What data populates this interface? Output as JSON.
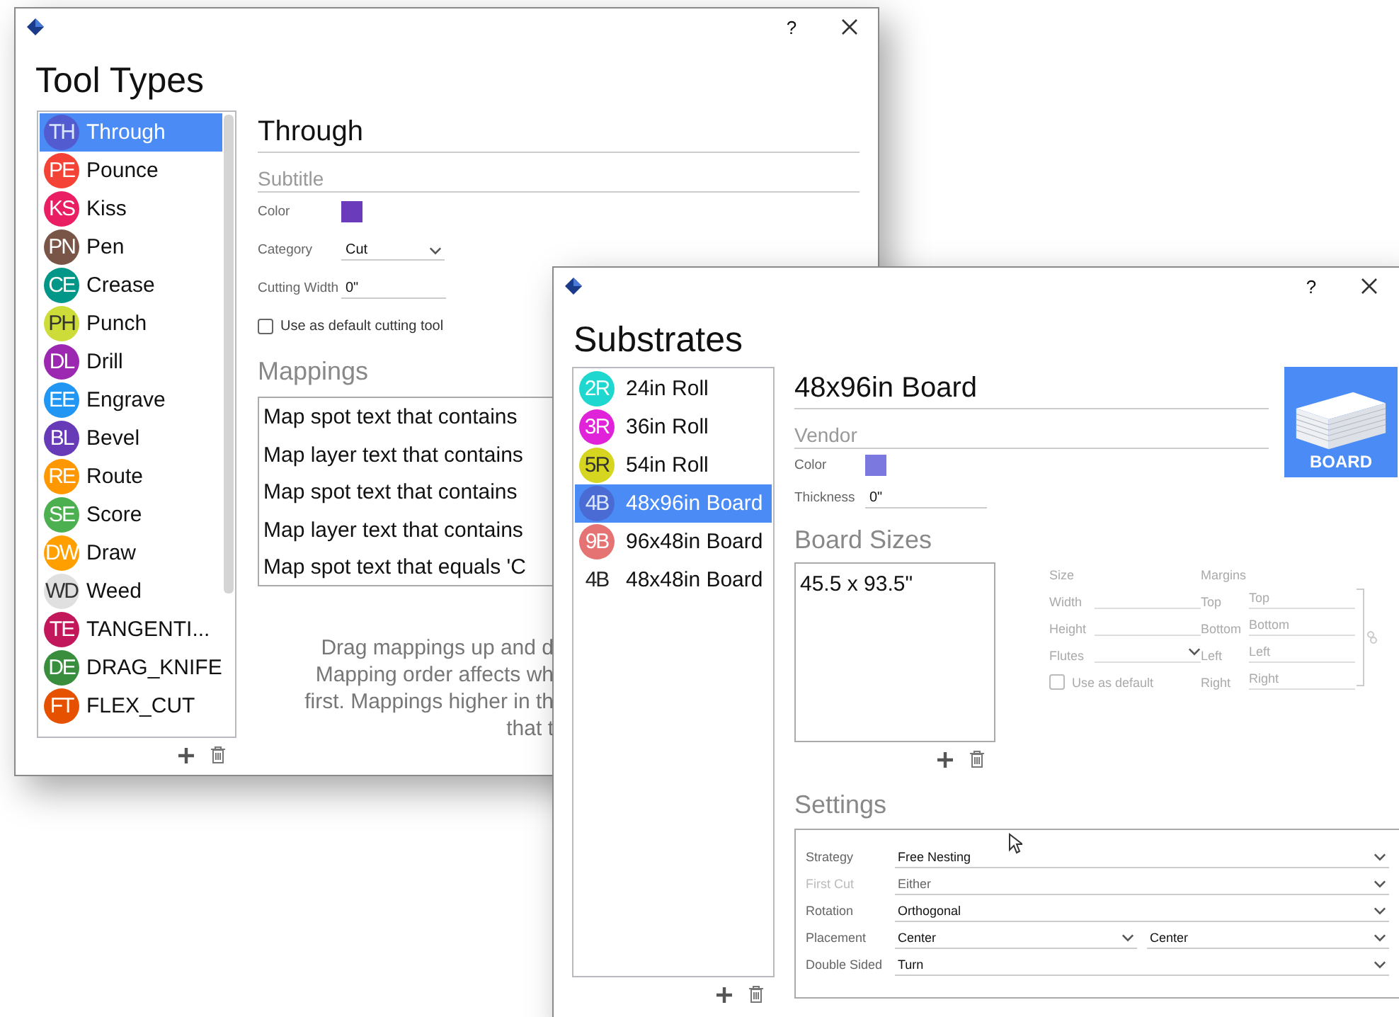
{
  "tool_types_window": {
    "help_button": "?",
    "title": "Tool Types",
    "tools": [
      {
        "initials": "TH",
        "label": "Through",
        "color": "#5450c8",
        "selected": true
      },
      {
        "initials": "PE",
        "label": "Pounce",
        "color": "#f44336",
        "selected": false
      },
      {
        "initials": "KS",
        "label": "Kiss",
        "color": "#e91e63",
        "selected": false
      },
      {
        "initials": "PN",
        "label": "Pen",
        "color": "#795548",
        "selected": false
      },
      {
        "initials": "CE",
        "label": "Crease",
        "color": "#009688",
        "selected": false
      },
      {
        "initials": "PH",
        "label": "Punch",
        "color": "#cddc39",
        "selected": false
      },
      {
        "initials": "DL",
        "label": "Drill",
        "color": "#9c27b0",
        "selected": false
      },
      {
        "initials": "EE",
        "label": "Engrave",
        "color": "#2196f3",
        "selected": false
      },
      {
        "initials": "BL",
        "label": "Bevel",
        "color": "#673ab7",
        "selected": false
      },
      {
        "initials": "RE",
        "label": "Route",
        "color": "#ff9800",
        "selected": false
      },
      {
        "initials": "SE",
        "label": "Score",
        "color": "#4caf50",
        "selected": false
      },
      {
        "initials": "DW",
        "label": "Draw",
        "color": "#ffa000",
        "selected": false
      },
      {
        "initials": "WD",
        "label": "Weed",
        "color": "#e0e0e0",
        "selected": false
      },
      {
        "initials": "TE",
        "label": "TANGENTI...",
        "color": "#c2185b",
        "selected": false
      },
      {
        "initials": "DE",
        "label": "DRAG_KNIFE",
        "color": "#388e3c",
        "selected": false
      },
      {
        "initials": "FT",
        "label": "FLEX_CUT",
        "color": "#e65100",
        "selected": false
      }
    ],
    "name": "Through",
    "subtitle_placeholder": "Subtitle",
    "color_label": "Color",
    "color": "#6a3cbc",
    "category_label": "Category",
    "category": "Cut",
    "cutting_width_label": "Cutting Width",
    "cutting_width": "0\"",
    "default_checkbox": {
      "label": "Use as default cutting tool",
      "checked": false
    },
    "mappings_heading": "Mappings",
    "mappings": [
      "Map spot text that contains",
      "Map layer text that contains",
      "Map spot text that contains",
      "Map layer text that contains",
      "Map spot text that equals 'C"
    ],
    "help_lines": [
      "Drag mappings up and d",
      "Mapping order affects wh",
      "first. Mappings higher in th",
      "that t"
    ]
  },
  "substrates_window": {
    "help_button": "?",
    "title": "Substrates",
    "substrates": [
      {
        "initials": "2R",
        "label": "24in Roll",
        "color": "#1ed8d0",
        "selected": false
      },
      {
        "initials": "3R",
        "label": "36in Roll",
        "color": "#e022d8",
        "selected": false
      },
      {
        "initials": "5R",
        "label": "54in Roll",
        "color": "#d6d620",
        "selected": false
      },
      {
        "initials": "4B",
        "label": "48x96in Board",
        "color": "#4a64cc",
        "selected": true
      },
      {
        "initials": "9B",
        "label": "96x48in Board",
        "color": "#e57373",
        "selected": false
      },
      {
        "initials": "4B",
        "label": "48x48in Board",
        "selected": false
      }
    ],
    "name": "48x96in Board",
    "vendor_placeholder": "Vendor",
    "color_label": "Color",
    "color": "#7b78e0",
    "thickness_label": "Thickness",
    "thickness": "0\"",
    "image_label": "BOARD",
    "board_sizes_heading": "Board Sizes",
    "board_sizes": [
      "45.5 x 93.5\""
    ],
    "size_heading": "Size",
    "width_label": "Width",
    "height_label": "Height",
    "flutes_label": "Flutes",
    "size_default_checkbox": {
      "label": "Use as default",
      "checked": false
    },
    "margins_heading": "Margins",
    "margins": [
      {
        "label": "Top",
        "placeholder": "Top"
      },
      {
        "label": "Bottom",
        "placeholder": "Bottom"
      },
      {
        "label": "Left",
        "placeholder": "Left"
      },
      {
        "label": "Right",
        "placeholder": "Right"
      }
    ],
    "settings_heading": "Settings",
    "settings": [
      {
        "label": "Strategy",
        "values": [
          "Free Nesting"
        ],
        "disabled": false
      },
      {
        "label": "First Cut",
        "values": [
          "Either"
        ],
        "disabled": true
      },
      {
        "label": "Rotation",
        "values": [
          "Orthogonal"
        ],
        "disabled": false
      },
      {
        "label": "Placement",
        "values": [
          "Center",
          "Center"
        ],
        "disabled": false
      },
      {
        "label": "Double Sided",
        "values": [
          "Turn"
        ],
        "disabled": false
      }
    ]
  }
}
